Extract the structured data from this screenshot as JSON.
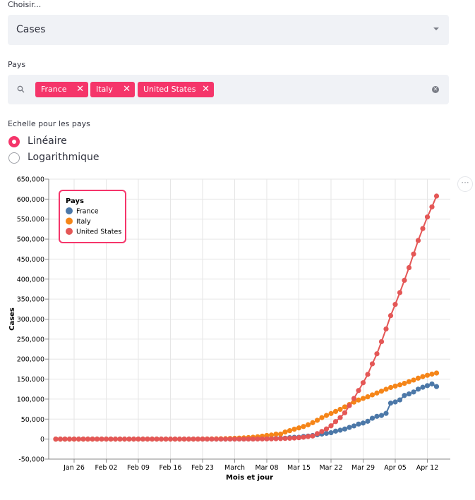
{
  "select": {
    "label": "Choisir...",
    "value": "Cases"
  },
  "countries": {
    "label": "Pays",
    "chips": [
      {
        "text": "France"
      },
      {
        "text": "Italy"
      },
      {
        "text": "United States"
      }
    ]
  },
  "scale": {
    "label": "Echelle pour les pays",
    "options": [
      {
        "text": "Linéaire",
        "selected": true
      },
      {
        "text": "Logarithmique",
        "selected": false
      }
    ]
  },
  "menu": {
    "text": "···"
  },
  "colors": {
    "accent": "#f5356a",
    "france": "#4c78a8",
    "italy": "#f58518",
    "us": "#e45756"
  },
  "chart_data": {
    "type": "line",
    "xlabel": "Mois et jour",
    "ylabel": "Cases",
    "ylim": [
      -50000,
      650000
    ],
    "yticks": [
      "650,000",
      "600,000",
      "550,000",
      "500,000",
      "450,000",
      "400,000",
      "350,000",
      "300,000",
      "250,000",
      "200,000",
      "150,000",
      "100,000",
      "50,000",
      "0",
      "-50,000"
    ],
    "xticks": [
      "Jan 26",
      "Feb 02",
      "Feb 09",
      "Feb 16",
      "Feb 23",
      "March",
      "Mar 08",
      "Mar 15",
      "Mar 22",
      "Mar 29",
      "Apr 05",
      "Apr 12"
    ],
    "x_start": "Jan 22",
    "x_end": "Apr 14",
    "grid": true,
    "legend": {
      "title": "Pays",
      "placement": "top-left"
    },
    "series": [
      {
        "name": "France",
        "color": "#4c78a8",
        "values": [
          0,
          0,
          0,
          3,
          3,
          4,
          5,
          5,
          6,
          6,
          6,
          6,
          6,
          6,
          11,
          11,
          11,
          11,
          11,
          11,
          11,
          12,
          12,
          12,
          12,
          12,
          12,
          12,
          12,
          12,
          12,
          12,
          12,
          12,
          14,
          18,
          38,
          57,
          100,
          130,
          191,
          212,
          285,
          423,
          653,
          949,
          1126,
          1209,
          1784,
          2281,
          2281,
          3661,
          4469,
          4499,
          6633,
          7652,
          9043,
          10871,
          12612,
          14459,
          16018,
          19856,
          22304,
          25233,
          29155,
          32964,
          37575,
          40174,
          44550,
          52128,
          56989,
          59105,
          64338,
          89953,
          92839,
          98010,
          109069,
          112950,
          117749,
          124869,
          129654,
          133670,
          137875,
          131361
        ]
      },
      {
        "name": "Italy",
        "color": "#f58518",
        "values": [
          0,
          0,
          0,
          0,
          0,
          0,
          0,
          0,
          0,
          2,
          2,
          2,
          2,
          2,
          3,
          3,
          3,
          3,
          3,
          3,
          3,
          3,
          3,
          3,
          3,
          3,
          3,
          3,
          3,
          20,
          62,
          155,
          229,
          322,
          453,
          655,
          888,
          1128,
          1694,
          2036,
          2502,
          3089,
          3858,
          4636,
          5883,
          7375,
          9172,
          10149,
          12462,
          12462,
          17660,
          21157,
          24747,
          27980,
          31506,
          35713,
          41035,
          47021,
          53578,
          59138,
          63927,
          69176,
          74386,
          80589,
          86498,
          92472,
          97689,
          101739,
          105792,
          110574,
          115242,
          119827,
          124632,
          128948,
          132547,
          135586,
          139422,
          143626,
          147577,
          152271,
          156363,
          159516,
          162488,
          165155
        ]
      },
      {
        "name": "United States",
        "color": "#e45756",
        "values": [
          1,
          1,
          2,
          2,
          5,
          5,
          5,
          5,
          5,
          7,
          8,
          8,
          11,
          11,
          11,
          11,
          11,
          11,
          11,
          11,
          12,
          12,
          13,
          13,
          13,
          13,
          13,
          13,
          13,
          13,
          15,
          15,
          15,
          51,
          51,
          57,
          58,
          60,
          68,
          74,
          98,
          118,
          149,
          217,
          262,
          402,
          518,
          583,
          959,
          1281,
          1663,
          2179,
          2727,
          3499,
          4632,
          6421,
          7786,
          13680,
          19101,
          25493,
          33276,
          43847,
          53740,
          65778,
          83836,
          101657,
          121465,
          140909,
          161831,
          188172,
          213242,
          243622,
          275367,
          308650,
          336802,
          366317,
          397121,
          428654,
          462780,
          496535,
          526396,
          555313,
          580619,
          607670
        ]
      }
    ]
  }
}
